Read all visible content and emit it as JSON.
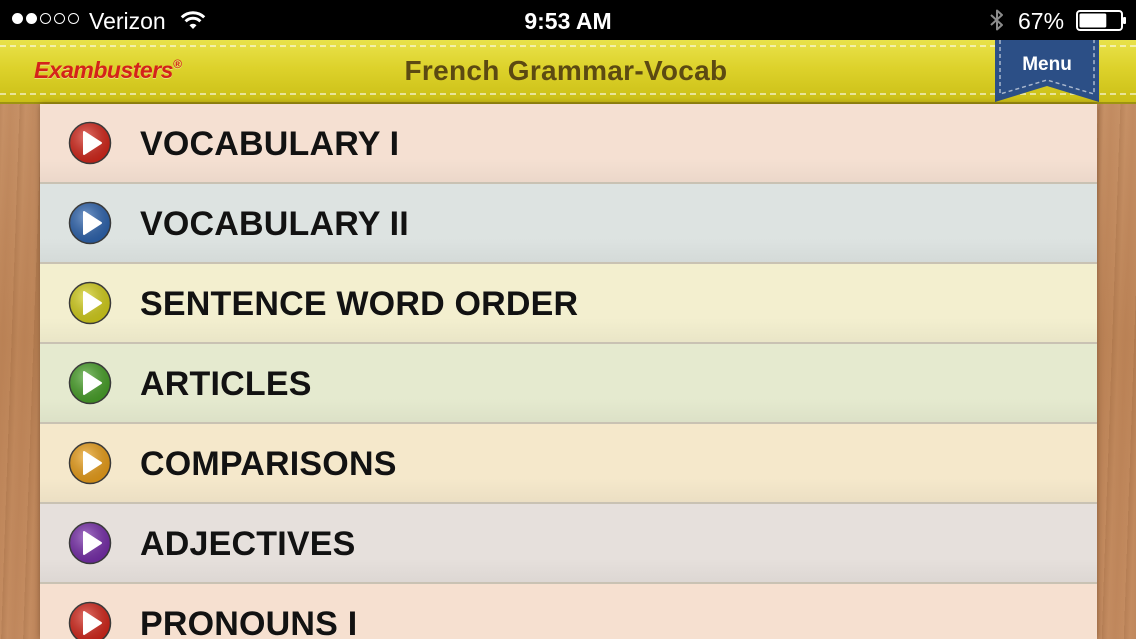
{
  "status_bar": {
    "signal_dots": [
      true,
      true,
      false,
      false,
      false
    ],
    "carrier": "Verizon",
    "wifi_icon": "wifi-icon",
    "time": "9:53 AM",
    "bluetooth_icon": "bluetooth-icon",
    "battery_percent": "67%",
    "battery_level": 0.67
  },
  "header": {
    "logo": "Exambusters",
    "logo_mark": "®",
    "title": "French Grammar-Vocab",
    "menu_label": "Menu",
    "bar_color": "#ddd22b",
    "menu_color": "#2c4f86"
  },
  "list": {
    "items": [
      {
        "label": "VOCABULARY I",
        "icon": "play-icon",
        "icon_color": "#d8281c",
        "bg": "#f5e0d2"
      },
      {
        "label": "VOCABULARY II",
        "icon": "play-icon",
        "icon_color": "#2f66b2",
        "bg": "#dde3e1"
      },
      {
        "label": "SENTENCE WORD ORDER",
        "icon": "play-icon",
        "icon_color": "#d8d31c",
        "bg": "#f3efcf"
      },
      {
        "label": "ARTICLES",
        "icon": "play-icon",
        "icon_color": "#4aa42a",
        "bg": "#e5eacf"
      },
      {
        "label": "COMPARISONS",
        "icon": "play-icon",
        "icon_color": "#efa21a",
        "bg": "#f5e8cb"
      },
      {
        "label": "ADJECTIVES",
        "icon": "play-icon",
        "icon_color": "#7a2fae",
        "bg": "#e6e0dc"
      },
      {
        "label": "PRONOUNS I",
        "icon": "play-icon",
        "icon_color": "#d8281c",
        "bg": "#f6e0d0"
      }
    ]
  }
}
